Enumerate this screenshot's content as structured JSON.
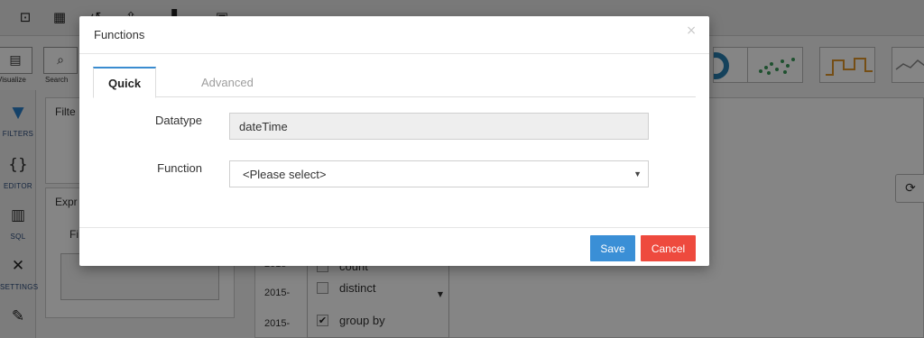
{
  "background": {
    "left_nav": [
      {
        "label": "FILTERS",
        "icon": "funnel-icon"
      },
      {
        "label": "EDITOR",
        "icon": "braces-icon"
      },
      {
        "label": "SQL",
        "icon": "database-icon"
      },
      {
        "label": "SETTINGS",
        "icon": "tools-icon"
      },
      {
        "label": "",
        "icon": "brush-icon"
      }
    ],
    "tools": [
      {
        "label": "Visualize",
        "icon": "visualize-icon"
      },
      {
        "label": "Search",
        "icon": "search-icon"
      }
    ],
    "panels": {
      "filter_title": "Filte",
      "expr_title": "Expr",
      "expr_sub": "Fi"
    },
    "rows": [
      "2015-",
      "2015-",
      "2015-"
    ],
    "aggregates": [
      {
        "label": "count",
        "checked": false
      },
      {
        "label": "distinct",
        "checked": false
      },
      {
        "label": "group by",
        "checked": true
      }
    ]
  },
  "modal": {
    "title": "Functions",
    "close_glyph": "×",
    "tabs": [
      {
        "label": "Quick",
        "active": true
      },
      {
        "label": "Advanced",
        "active": false
      }
    ],
    "fields": {
      "datatype_label": "Datatype",
      "datatype_value": "dateTime",
      "function_label": "Function",
      "function_value": "<Please select>"
    },
    "buttons": {
      "save": "Save",
      "cancel": "Cancel"
    }
  },
  "colors": {
    "save_button": "#3a8fd6",
    "cancel_button": "#ee4a3e",
    "active_tab_accent": "#3a8cd0"
  }
}
